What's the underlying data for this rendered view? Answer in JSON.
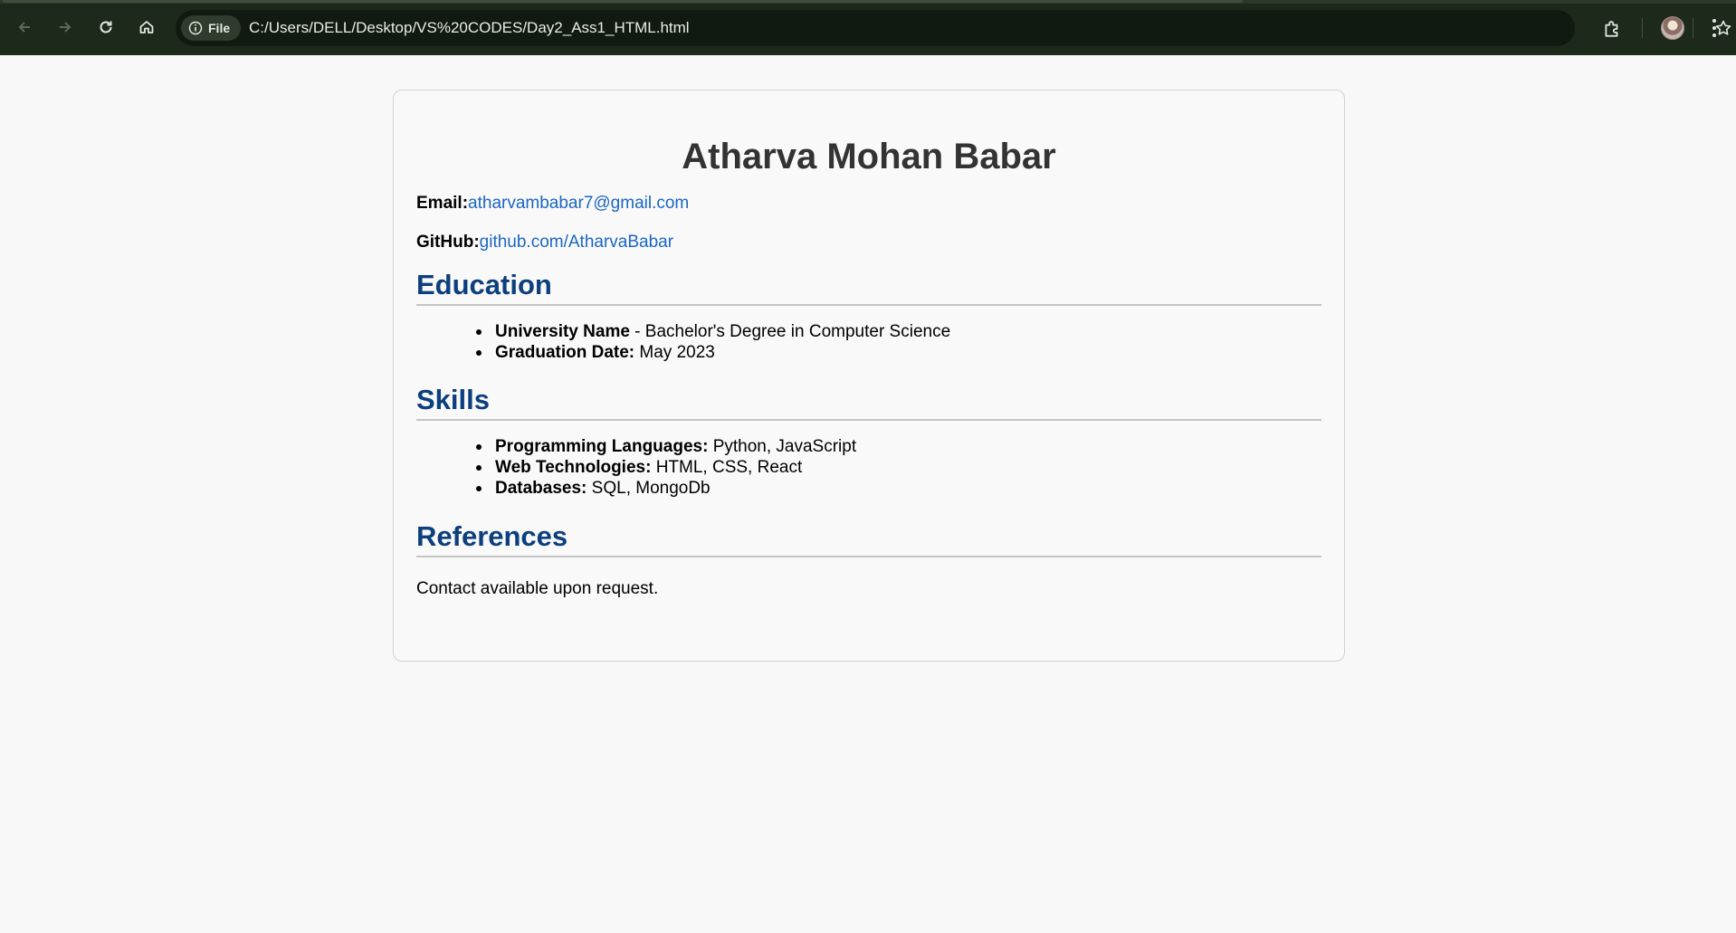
{
  "browser": {
    "site_chip_label": "File",
    "url": "C:/Users/DELL/Desktop/VS%20CODES/Day2_Ass1_HTML.html",
    "icons": [
      "back-arrow-icon",
      "forward-arrow-icon",
      "reload-icon",
      "home-icon",
      "info-icon",
      "star-icon",
      "extensions-icon",
      "profile-avatar",
      "more-menu-icon"
    ]
  },
  "resume": {
    "name": "Atharva Mohan Babar",
    "email_label": "Email:",
    "email": "atharvambabar7@gmail.com",
    "github_label": "GitHub:",
    "github": "github.com/AtharvaBabar",
    "education": {
      "heading": "Education",
      "items": [
        {
          "label": "University Name",
          "value": " - Bachelor's Degree in Computer Science"
        },
        {
          "label": "Graduation Date:",
          "value": " May 2023"
        }
      ]
    },
    "skills": {
      "heading": "Skills",
      "items": [
        {
          "label": "Programming Languages:",
          "value": " Python, JavaScript"
        },
        {
          "label": "Web Technologies:",
          "value": " HTML, CSS, React"
        },
        {
          "label": "Databases:",
          "value": " SQL, MongoDb"
        }
      ]
    },
    "references": {
      "heading": "References",
      "text": "Contact available upon request."
    }
  },
  "colors": {
    "heading": "#0c3f7d",
    "link": "#1a66c2",
    "chrome": "#1d2a1b"
  }
}
